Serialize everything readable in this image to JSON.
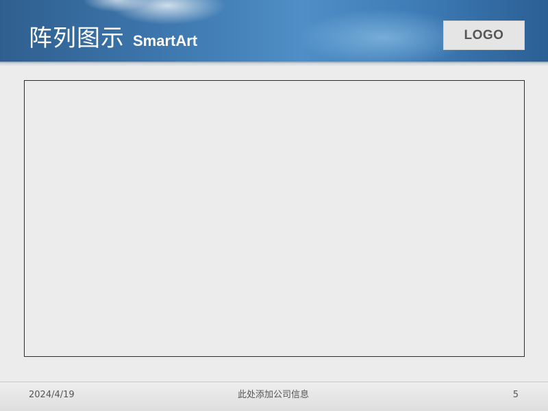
{
  "slide": {
    "title": "阵列图示",
    "subtitle": "SmartArt",
    "logo_text": "LOGO"
  },
  "footer": {
    "date": "2024/4/19",
    "company_info": "此处添加公司信息",
    "page_number": "5"
  },
  "theme": {
    "header_blue": "#3d77ae",
    "background": "#ececec",
    "frame_border": "#2b2b2b"
  }
}
